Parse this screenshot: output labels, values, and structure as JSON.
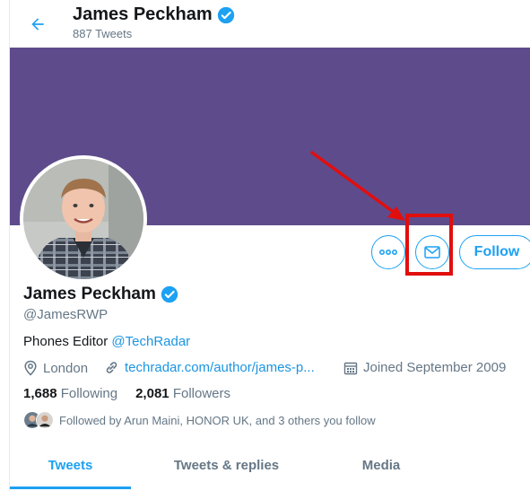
{
  "header": {
    "name": "James Peckham",
    "tweet_count": "887 Tweets"
  },
  "colors": {
    "banner": "#5e4b8c",
    "accent": "#1da1f2",
    "annotation": "#e10e0e"
  },
  "actions": {
    "follow_label": "Follow",
    "more_icon": "more-icon",
    "message_icon": "envelope-icon"
  },
  "profile": {
    "name": "James Peckham",
    "handle": "@JamesRWP",
    "bio_text": "Phones Editor ",
    "bio_link": "@TechRadar",
    "location": "London",
    "website": "techradar.com/author/james-p...",
    "joined": "Joined September 2009",
    "following_count": "1,688",
    "following_label": "Following",
    "followers_count": "2,081",
    "followers_label": "Followers",
    "followed_by": "Followed by Arun Maini, HONOR UK, and 3 others you follow"
  },
  "tabs": [
    {
      "label": "Tweets",
      "active": true
    },
    {
      "label": "Tweets & replies",
      "active": false
    },
    {
      "label": "Media",
      "active": false
    }
  ]
}
